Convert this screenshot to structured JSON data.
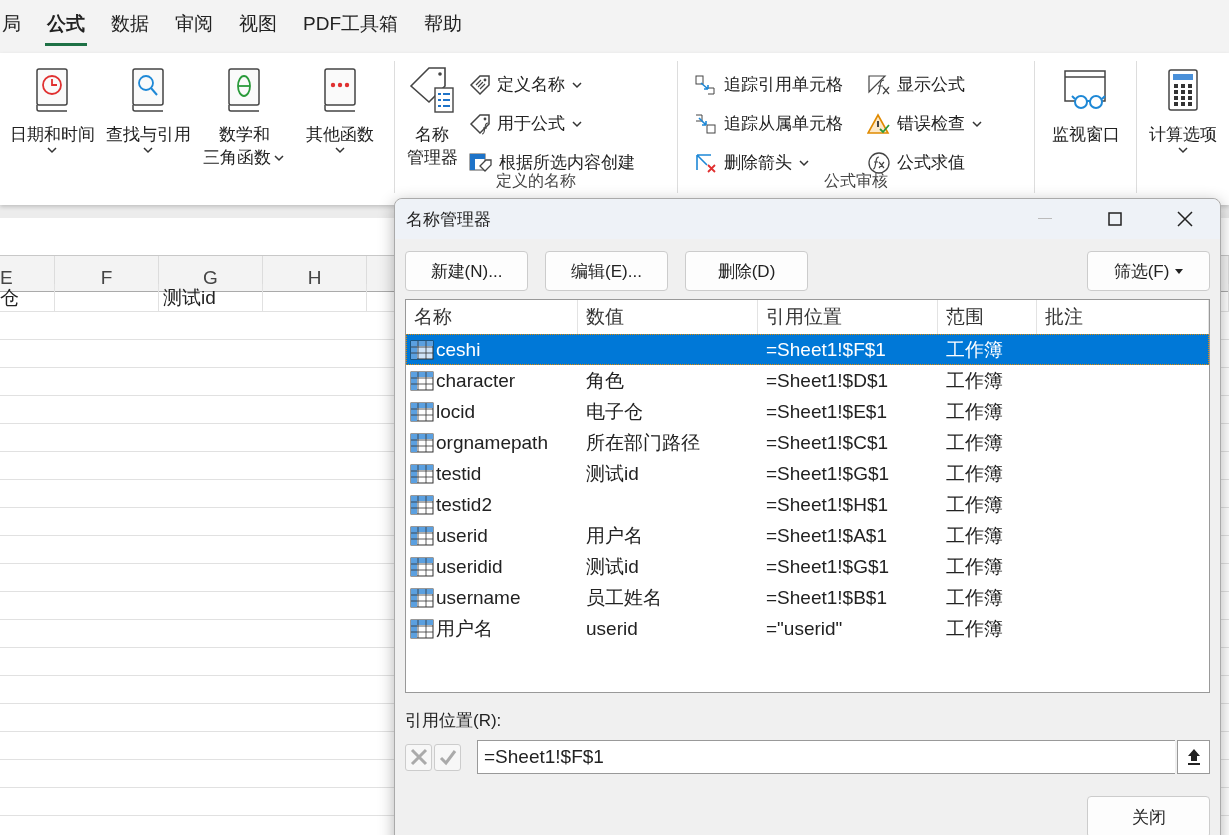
{
  "ribbon_tabs": [
    {
      "label": "局",
      "selected": false
    },
    {
      "label": "公式",
      "selected": true
    },
    {
      "label": "数据",
      "selected": false
    },
    {
      "label": "审阅",
      "selected": false
    },
    {
      "label": "视图",
      "selected": false
    },
    {
      "label": "PDF工具箱",
      "selected": false
    },
    {
      "label": "帮助",
      "selected": false
    }
  ],
  "function_library": [
    {
      "lines": [
        "日期和时间"
      ],
      "dropdown": true
    },
    {
      "lines": [
        "查找与引用"
      ],
      "dropdown": true
    },
    {
      "lines": [
        "数学和",
        "三角函数"
      ],
      "dropdown": true
    },
    {
      "lines": [
        "其他函数"
      ],
      "dropdown": true
    }
  ],
  "defined_names": {
    "manager_button": [
      "名称",
      "管理器"
    ],
    "commands": [
      {
        "label": "定义名称",
        "dropdown": true
      },
      {
        "label": "用于公式",
        "dropdown": true
      },
      {
        "label": "根据所选内容创建",
        "dropdown": false
      }
    ],
    "group_label": "定义的名称"
  },
  "formula_auditing": {
    "commands": [
      {
        "label": "追踪引用单元格",
        "dropdown": false
      },
      {
        "label": "追踪从属单元格",
        "dropdown": false
      },
      {
        "label": "删除箭头",
        "dropdown": true
      },
      {
        "label": "显示公式",
        "dropdown": false
      },
      {
        "label": "错误检查",
        "dropdown": true
      },
      {
        "label": "公式求值",
        "dropdown": false
      }
    ],
    "group_label": "公式审核"
  },
  "watch_window": {
    "label": "监视窗口",
    "dropdown": false
  },
  "calculation_options": {
    "label": "计算选项",
    "dropdown": true
  },
  "sheet": {
    "columns": [
      "E",
      "F",
      "G",
      "H"
    ],
    "rows": [
      [
        "仓",
        null,
        "测试id",
        null
      ]
    ]
  },
  "dialog": {
    "title": "名称管理器",
    "buttons": [
      "新建(N)...",
      "编辑(E)...",
      "删除(D)"
    ],
    "filter_button": "筛选(F)",
    "columns": [
      "名称",
      "数值",
      "引用位置",
      "范围",
      "批注"
    ],
    "rows": [
      {
        "name": "ceshi",
        "refers_to": "=Sheet1!$F$1",
        "scope": "工作簿",
        "selected": true
      },
      {
        "name": "character",
        "value": "角色",
        "refers_to": "=Sheet1!$D$1",
        "scope": "工作簿",
        "selected": false
      },
      {
        "name": "locid",
        "value": "电子仓",
        "refers_to": "=Sheet1!$E$1",
        "scope": "工作簿",
        "selected": false
      },
      {
        "name": "orgnamepath",
        "value": "所在部门路径",
        "refers_to": "=Sheet1!$C$1",
        "scope": "工作簿",
        "selected": false
      },
      {
        "name": "testid",
        "value": "测试id",
        "refers_to": "=Sheet1!$G$1",
        "scope": "工作簿",
        "selected": false
      },
      {
        "name": "testid2",
        "refers_to": "=Sheet1!$H$1",
        "scope": "工作簿",
        "selected": false
      },
      {
        "name": "userid",
        "value": "用户名",
        "refers_to": "=Sheet1!$A$1",
        "scope": "工作簿",
        "selected": false
      },
      {
        "name": "useridid",
        "value": "测试id",
        "refers_to": "=Sheet1!$G$1",
        "scope": "工作簿",
        "selected": false
      },
      {
        "name": "username",
        "value": "员工姓名",
        "refers_to": "=Sheet1!$B$1",
        "scope": "工作簿",
        "selected": false
      },
      {
        "name": "用户名",
        "value": "userid",
        "refers_to": "=\"userid\"",
        "scope": "工作簿",
        "selected": false
      }
    ],
    "refers_to_label": "引用位置(R):",
    "refers_to_value": "=Sheet1!$F$1",
    "close_button": "关闭"
  }
}
